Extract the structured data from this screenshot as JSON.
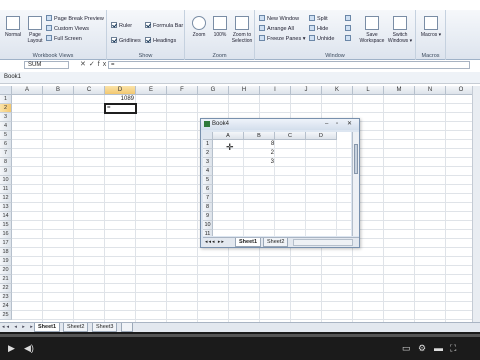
{
  "ribbon": {
    "workbook_views": {
      "label": "Workbook Views",
      "normal": "Normal",
      "page_layout": "Page Layout",
      "page_break_preview": "Page Break Preview",
      "custom_views": "Custom Views",
      "full_screen": "Full Screen"
    },
    "show": {
      "label": "Show",
      "ruler": "Ruler",
      "formula_bar": "Formula Bar",
      "gridlines": "Gridlines",
      "headings": "Headings"
    },
    "zoom": {
      "label": "Zoom",
      "zoom": "Zoom",
      "hundred": "100%",
      "zoom_to_selection": "Zoom to Selection"
    },
    "window": {
      "label": "Window",
      "new_window": "New Window",
      "arrange_all": "Arrange All",
      "freeze_panes": "Freeze Panes",
      "split": "Split",
      "hide": "Hide",
      "unhide": "Unhide",
      "save_workspace": "Save Workspace",
      "switch_windows": "Switch Windows"
    },
    "macros": {
      "label": "Macros",
      "macros": "Macros"
    }
  },
  "formula_bar": {
    "name_box": "SUM",
    "fx": "fx",
    "value": "="
  },
  "workbook_title": "Book1",
  "main_grid": {
    "columns": [
      "A",
      "B",
      "C",
      "D",
      "E",
      "F",
      "G",
      "H",
      "I",
      "J",
      "K",
      "L",
      "M",
      "N",
      "O"
    ],
    "rows": [
      "1",
      "2",
      "3",
      "4",
      "5",
      "6",
      "7",
      "8",
      "9",
      "10",
      "11",
      "12",
      "13",
      "14",
      "15",
      "16",
      "17",
      "18",
      "19",
      "20",
      "21",
      "22",
      "23",
      "24",
      "25"
    ],
    "cells": {
      "D1": "1089",
      "D2": "="
    }
  },
  "sheet_tabs": [
    "Sheet1",
    "Sheet2",
    "Sheet3"
  ],
  "book4": {
    "title": "Book4",
    "columns": [
      "A",
      "B",
      "C",
      "D"
    ],
    "rows": [
      "1",
      "2",
      "3",
      "4",
      "5",
      "6",
      "7",
      "8",
      "9",
      "10",
      "11"
    ],
    "cells": {
      "B1": "8",
      "C2": "2",
      "C3": "3"
    },
    "tabs": [
      "Sheet1",
      "Sheet2"
    ]
  },
  "player": {
    "progress": 0.0
  }
}
